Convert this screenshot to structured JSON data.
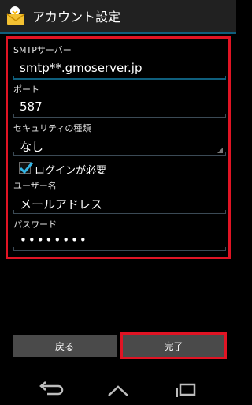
{
  "header": {
    "title": "アカウント設定",
    "icon": "mail-icon"
  },
  "form": {
    "smtp": {
      "label": "SMTPサーバー",
      "value": "smtp**.gmoserver.jp"
    },
    "port": {
      "label": "ポート",
      "value": "587"
    },
    "security": {
      "label": "セキュリティの種類",
      "value": "なし"
    },
    "login_required": {
      "label": "ログインが必要",
      "checked": true
    },
    "username": {
      "label": "ユーザー名",
      "value": "メールアドレス"
    },
    "password": {
      "label": "パスワード",
      "value": "••••••••"
    }
  },
  "buttons": {
    "back": "戻る",
    "done": "完了"
  },
  "colors": {
    "highlight": "#e01424",
    "accent": "#0f5f7d",
    "background": "#000000"
  }
}
